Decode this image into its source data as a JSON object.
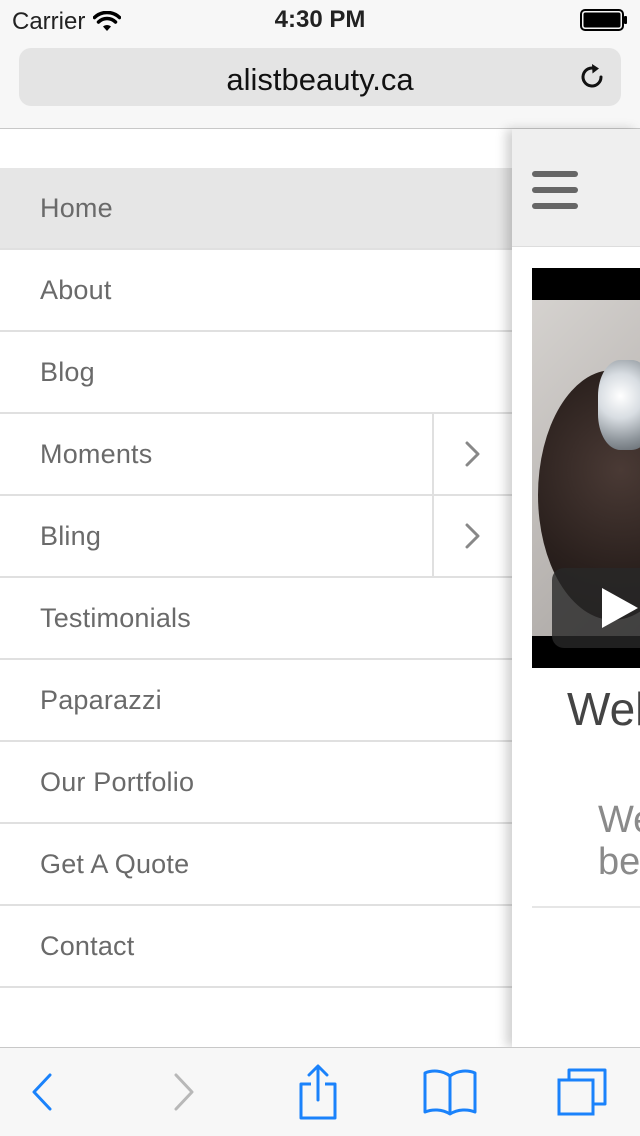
{
  "status_bar": {
    "carrier": "Carrier",
    "time": "4:30 PM"
  },
  "browser": {
    "url": "alistbeauty.ca"
  },
  "menu": {
    "items": [
      {
        "label": "Home",
        "active": true,
        "has_submenu": false
      },
      {
        "label": "About",
        "active": false,
        "has_submenu": false
      },
      {
        "label": "Blog",
        "active": false,
        "has_submenu": false
      },
      {
        "label": "Moments",
        "active": false,
        "has_submenu": true
      },
      {
        "label": "Bling",
        "active": false,
        "has_submenu": true
      },
      {
        "label": "Testimonials",
        "active": false,
        "has_submenu": false
      },
      {
        "label": "Paparazzi",
        "active": false,
        "has_submenu": false
      },
      {
        "label": "Our Portfolio",
        "active": false,
        "has_submenu": false
      },
      {
        "label": "Get A Quote",
        "active": false,
        "has_submenu": false
      },
      {
        "label": "Contact",
        "active": false,
        "has_submenu": false
      }
    ]
  },
  "main": {
    "heading": "Wel",
    "subtext_line1": "We",
    "subtext_line2": "be"
  },
  "icons": {
    "reload": "reload-icon",
    "menu": "hamburger-menu-icon",
    "play": "play-icon",
    "back": "back-icon",
    "forward": "forward-icon",
    "share": "share-icon",
    "bookmarks": "bookmarks-icon",
    "tabs": "tabs-icon"
  },
  "colors": {
    "ios_blue": "#1a82fb",
    "menu_active_bg": "#e6e6e6",
    "menu_text": "#6a6a6a"
  }
}
